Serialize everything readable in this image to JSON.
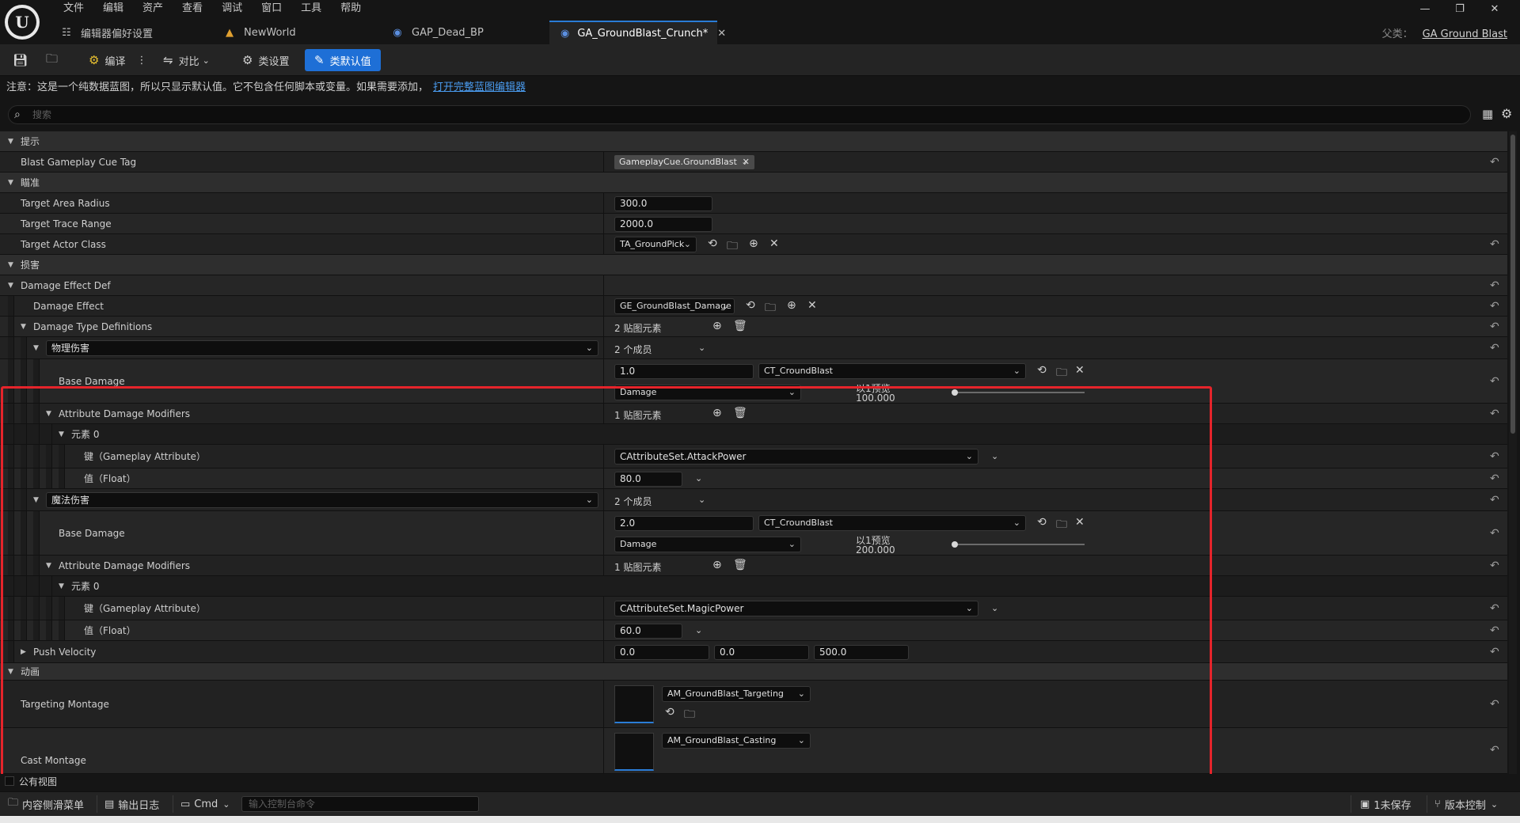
{
  "menu": [
    "文件",
    "编辑",
    "资产",
    "查看",
    "调试",
    "窗口",
    "工具",
    "帮助"
  ],
  "tabs": [
    {
      "label": "编辑器偏好设置",
      "icon": "sliders-icon"
    },
    {
      "label": "NewWorld",
      "icon": "level-icon"
    },
    {
      "label": "GAP_Dead_BP",
      "icon": "blueprint-icon"
    },
    {
      "label": "GA_GroundBlast_Crunch*",
      "icon": "blueprint-icon"
    }
  ],
  "window": {
    "parent_label": "父类：",
    "parent_class": "GA Ground Blast"
  },
  "toolbar": {
    "compile": "编译",
    "diff": "对比",
    "class_settings": "类设置",
    "class_defaults": "类默认值"
  },
  "notice": {
    "text": "注意：这是一个纯数据蓝图，所以只显示默认值。它不包含任何脚本或变量。如果需要添加，",
    "link": "打开完整蓝图编辑器"
  },
  "search": {
    "placeholder": "搜索"
  },
  "details": {
    "cat_hint": "提示",
    "blast_cue_tag_label": "Blast Gameplay Cue Tag",
    "blast_cue_tag_value": "GameplayCue.GroundBlast",
    "cat_aim": "瞄准",
    "target_area_radius_label": "Target Area Radius",
    "target_area_radius": "300.0",
    "target_trace_range_label": "Target Trace Range",
    "target_trace_range": "2000.0",
    "target_actor_class_label": "Target Actor Class",
    "target_actor_class": "TA_GroundPick",
    "cat_damage": "损害",
    "damage_effect_def": "Damage Effect Def",
    "damage_effect_label": "Damage Effect",
    "damage_effect": "GE_GroundBlast_Damage",
    "damage_type_defs_label": "Damage Type Definitions",
    "damage_type_defs_count": "2 贴图元素",
    "physical": {
      "key": "物理伤害",
      "members": "2 个成员",
      "base_damage_label": "Base Damage",
      "base_damage": "1.0",
      "curve_table": "CT_CroundBlast",
      "curve_row": "Damage",
      "preview_label": "以1预览",
      "preview_value": "100.000",
      "preview_ratio": 0.0,
      "modifiers_label": "Attribute Damage Modifiers",
      "modifiers_count": "1 贴图元素",
      "element_label": "元素 0",
      "key_label": "键（Gameplay Attribute）",
      "attribute": "CAttributeSet.AttackPower",
      "value_label": "值（Float）",
      "value": "80.0"
    },
    "magic": {
      "key": "魔法伤害",
      "members": "2 个成员",
      "base_damage_label": "Base Damage",
      "base_damage": "2.0",
      "curve_table": "CT_CroundBlast",
      "curve_row": "Damage",
      "preview_label": "以1预览",
      "preview_value": "200.000",
      "preview_ratio": 0.0,
      "modifiers_label": "Attribute Damage Modifiers",
      "modifiers_count": "1 贴图元素",
      "element_label": "元素 0",
      "key_label": "键（Gameplay Attribute）",
      "attribute": "CAttributeSet.MagicPower",
      "value_label": "值（Float）",
      "value": "60.0"
    },
    "push_velocity_label": "Push Velocity",
    "push_velocity": [
      "0.0",
      "0.0",
      "500.0"
    ],
    "cat_anim": "动画",
    "targeting_montage_label": "Targeting Montage",
    "targeting_montage": "AM_GroundBlast_Targeting",
    "cast_montage_label": "Cast Montage",
    "cast_montage": "AM_GroundBlast_Casting"
  },
  "public_view": "公有视图",
  "status": {
    "content_drawer": "内容侧滑菜单",
    "output_log": "输出日志",
    "cmd": "Cmd",
    "cmd_placeholder": "输入控制台命令",
    "unsaved": "1未保存",
    "source_control": "版本控制"
  },
  "colors": {
    "accent": "#1e6fd6",
    "highlight": "#e5242b",
    "link": "#4a9cf0"
  }
}
